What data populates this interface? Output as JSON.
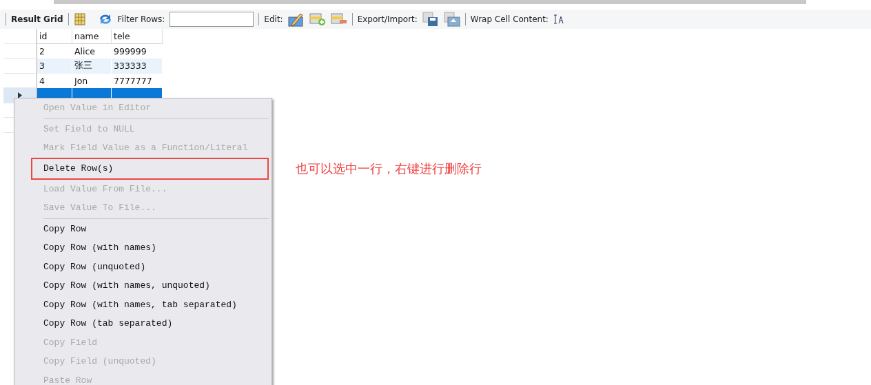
{
  "toolbar": {
    "title": "Result Grid",
    "filter_label": "Filter Rows:",
    "edit_label": "Edit:",
    "export_label": "Export/Import:",
    "wrap_label": "Wrap Cell Content:"
  },
  "table": {
    "columns": [
      "id",
      "name",
      "tele"
    ],
    "rows": [
      {
        "cells": [
          "2",
          "Alice",
          "999999"
        ],
        "selected": false,
        "current": false
      },
      {
        "cells": [
          "3",
          "张三",
          "333333"
        ],
        "selected": false,
        "current": false
      },
      {
        "cells": [
          "4",
          "Jon",
          "7777777"
        ],
        "selected": false,
        "current": false
      },
      {
        "selected": true,
        "current": true
      }
    ]
  },
  "context_menu": {
    "items": [
      {
        "kind": "item",
        "label": "Open Value in Editor",
        "disabled": true,
        "highlighted": false
      },
      {
        "kind": "separator"
      },
      {
        "kind": "item",
        "label": "Set Field to NULL",
        "disabled": true,
        "highlighted": false
      },
      {
        "kind": "item",
        "label": "Mark Field Value as a Function/Literal",
        "disabled": true,
        "highlighted": false
      },
      {
        "kind": "item",
        "label": "Delete Row(s)",
        "disabled": false,
        "highlighted": true
      },
      {
        "kind": "item",
        "label": "Load Value From File...",
        "disabled": true,
        "highlighted": false
      },
      {
        "kind": "item",
        "label": "Save Value To File...",
        "disabled": true,
        "highlighted": false
      },
      {
        "kind": "separator"
      },
      {
        "kind": "item",
        "label": "Copy Row",
        "disabled": false,
        "highlighted": false
      },
      {
        "kind": "item",
        "label": "Copy Row (with names)",
        "disabled": false,
        "highlighted": false
      },
      {
        "kind": "item",
        "label": "Copy Row (unquoted)",
        "disabled": false,
        "highlighted": false
      },
      {
        "kind": "item",
        "label": "Copy Row (with names, unquoted)",
        "disabled": false,
        "highlighted": false
      },
      {
        "kind": "item",
        "label": "Copy Row (with names, tab separated)",
        "disabled": false,
        "highlighted": false
      },
      {
        "kind": "item",
        "label": "Copy Row (tab separated)",
        "disabled": false,
        "highlighted": false
      },
      {
        "kind": "item",
        "label": "Copy Field",
        "disabled": true,
        "highlighted": false
      },
      {
        "kind": "item",
        "label": "Copy Field (unquoted)",
        "disabled": true,
        "highlighted": false
      },
      {
        "kind": "item",
        "label": "Paste Row",
        "disabled": true,
        "highlighted": false
      }
    ]
  },
  "annotation": "也可以选中一行，右键进行删除行"
}
